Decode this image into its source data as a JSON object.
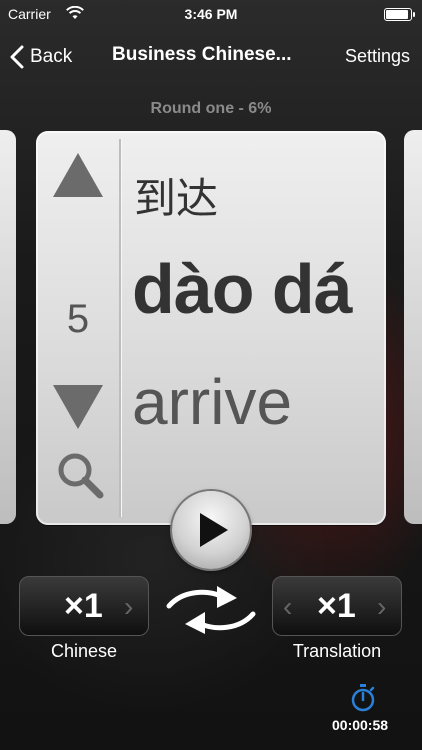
{
  "status_bar": {
    "carrier": "Carrier",
    "time": "3:46 PM"
  },
  "nav": {
    "back_label": "Back",
    "title": "Business Chinese...",
    "settings_label": "Settings"
  },
  "progress": {
    "round_text": "Round one - 6%",
    "percent": 6
  },
  "card": {
    "count": "5",
    "hanzi": "到达",
    "pinyin": "dào dá",
    "english": "arrive"
  },
  "controls": {
    "chinese_multiplier": "×1",
    "chinese_label": "Chinese",
    "translation_multiplier": "×1",
    "translation_label": "Translation",
    "chev_left": "‹",
    "chev_right": "›"
  },
  "timer": {
    "elapsed": "00:00:58"
  },
  "colors": {
    "accent": "#2a7fd6"
  },
  "icons": [
    "back-chevron-icon",
    "wifi-icon",
    "battery-icon",
    "up-arrow-icon",
    "down-arrow-icon",
    "magnifier-icon",
    "play-icon",
    "swap-icon",
    "stopwatch-icon"
  ]
}
